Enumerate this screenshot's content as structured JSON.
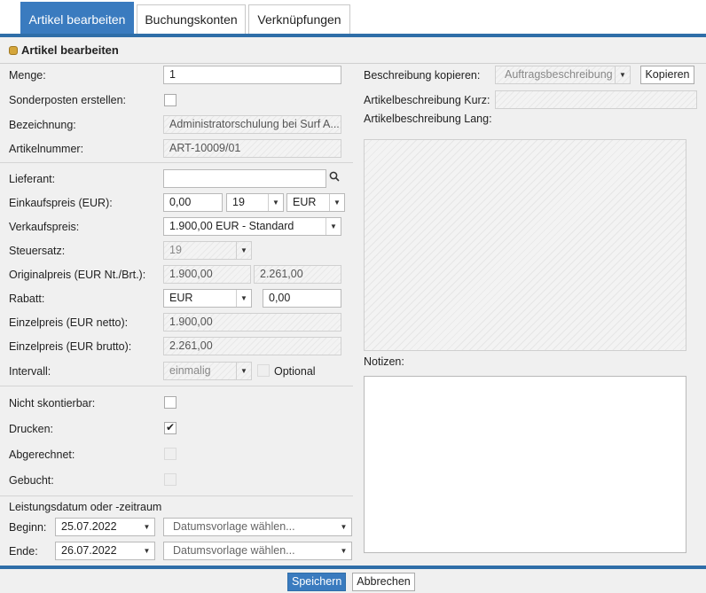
{
  "tabs": [
    "Artikel bearbeiten",
    "Buchungskonten",
    "Verknüpfungen"
  ],
  "section_title": "Artikel bearbeiten",
  "fields": {
    "menge_label": "Menge:",
    "menge_value": "1",
    "sonderposten_label": "Sonderposten erstellen:",
    "bezeichnung_label": "Bezeichnung:",
    "bezeichnung_value": "Administratorschulung bei Surf A...",
    "artikelnummer_label": "Artikelnummer:",
    "artikelnummer_value": "ART-10009/01",
    "lieferant_label": "Lieferant:",
    "lieferant_value": "",
    "einkaufspreis_label": "Einkaufspreis (EUR):",
    "einkaufspreis_value": "0,00",
    "einkaufspreis_tax": "19",
    "einkaufspreis_currency": "EUR",
    "verkaufspreis_label": "Verkaufspreis:",
    "verkaufspreis_value": "1.900,00 EUR - Standard",
    "steuersatz_label": "Steuersatz:",
    "steuersatz_value": "19",
    "originalpreis_label": "Originalpreis (EUR Nt./Brt.):",
    "originalpreis_netto": "1.900,00",
    "originalpreis_brutto": "2.261,00",
    "rabatt_label": "Rabatt:",
    "rabatt_type": "EUR",
    "rabatt_value": "0,00",
    "einzelpreis_netto_label": "Einzelpreis (EUR netto):",
    "einzelpreis_netto_value": "1.900,00",
    "einzelpreis_brutto_label": "Einzelpreis (EUR brutto):",
    "einzelpreis_brutto_value": "2.261,00",
    "intervall_label": "Intervall:",
    "intervall_value": "einmalig",
    "optional_label": "Optional",
    "nicht_skontierbar_label": "Nicht skontierbar:",
    "drucken_label": "Drucken:",
    "abgerechnet_label": "Abgerechnet:",
    "gebucht_label": "Gebucht:",
    "leistungsdatum_label": "Leistungsdatum oder -zeitraum",
    "beginn_label": "Beginn:",
    "beginn_value": "25.07.2022",
    "ende_label": "Ende:",
    "ende_value": "26.07.2022",
    "datumsvorlage_placeholder": "Datumsvorlage wählen...",
    "beschreibung_kopieren_label": "Beschreibung kopieren:",
    "beschreibung_kopieren_value": "Auftragsbeschreibung",
    "kopieren_button": "Kopieren",
    "kurz_label": "Artikelbeschreibung Kurz:",
    "lang_label": "Artikelbeschreibung Lang:",
    "notizen_label": "Notizen:"
  },
  "checkboxes": {
    "sonderposten": false,
    "optional": false,
    "nicht_skontierbar": false,
    "drucken": true,
    "abgerechnet": false,
    "gebucht": false
  },
  "icons": {
    "search": "search-icon",
    "dropdown": "chevron-down-icon",
    "coins": "coins-icon",
    "check": "checkmark-icon"
  },
  "footer": {
    "save": "Speichern",
    "cancel": "Abbrechen"
  },
  "colors": {
    "accent": "#3a7bbf",
    "panel": "#f0f0f0"
  }
}
